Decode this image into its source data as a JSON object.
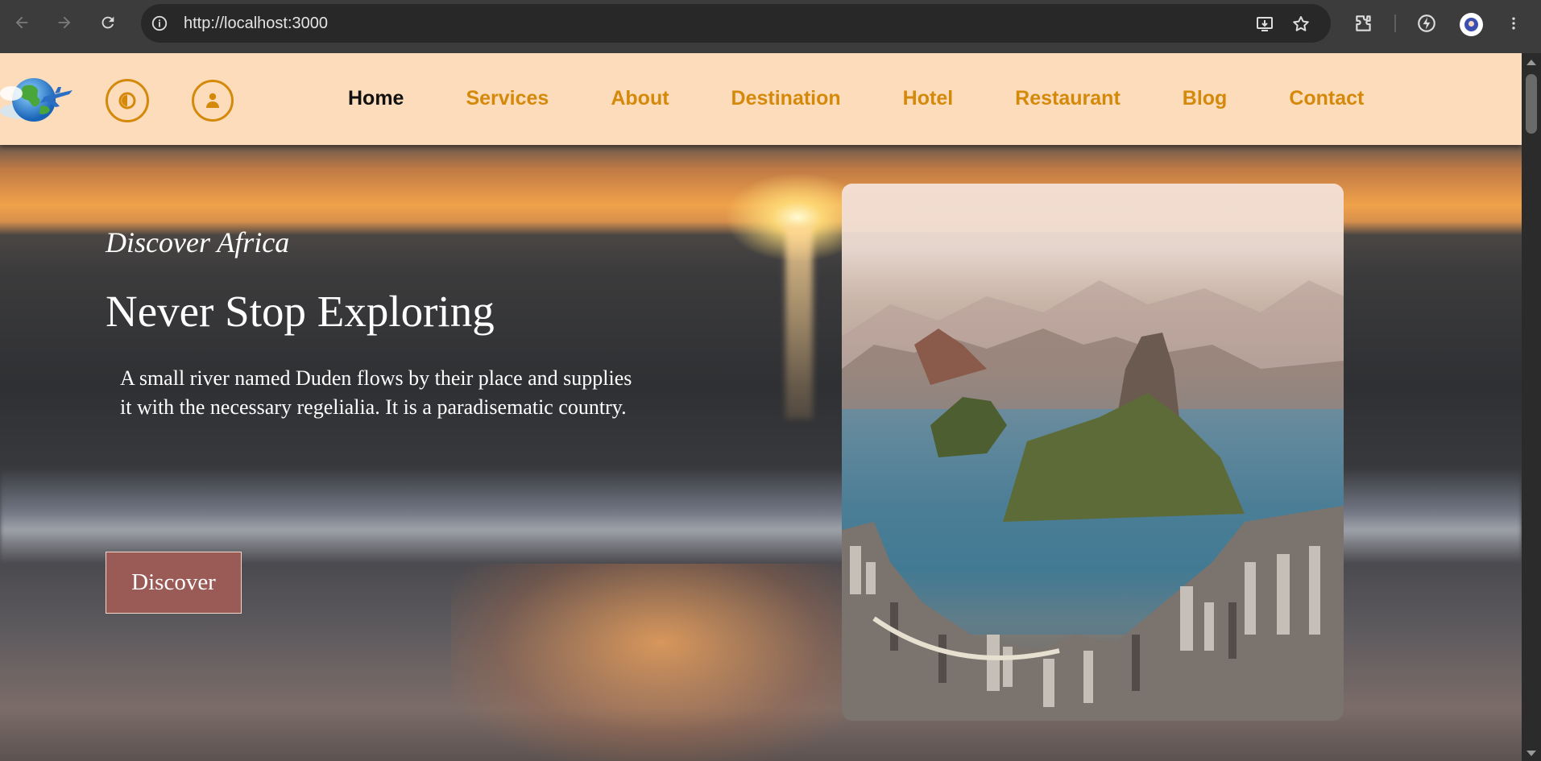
{
  "browser": {
    "url": "http://localhost:3000"
  },
  "header": {
    "nav": [
      {
        "label": "Home",
        "active": true
      },
      {
        "label": "Services",
        "active": false
      },
      {
        "label": "About",
        "active": false
      },
      {
        "label": "Destination",
        "active": false
      },
      {
        "label": "Hotel",
        "active": false
      },
      {
        "label": "Restaurant",
        "active": false
      },
      {
        "label": "Blog",
        "active": false
      },
      {
        "label": "Contact",
        "active": false
      }
    ],
    "icons": {
      "theme": "contrast-icon",
      "account": "user-icon",
      "logo": "globe-airplane-logo"
    }
  },
  "hero": {
    "eyebrow": "Discover Africa",
    "title": "Never Stop Exploring",
    "description": "A small river named Duden flows by their place and supplies it with the necessary regelialia. It is a paradisematic country.",
    "button": "Discover"
  },
  "colors": {
    "accent": "#d4890a",
    "header_bg": "#fddcbc",
    "button_bg": "#9a5a55",
    "active_nav": "#111111"
  }
}
